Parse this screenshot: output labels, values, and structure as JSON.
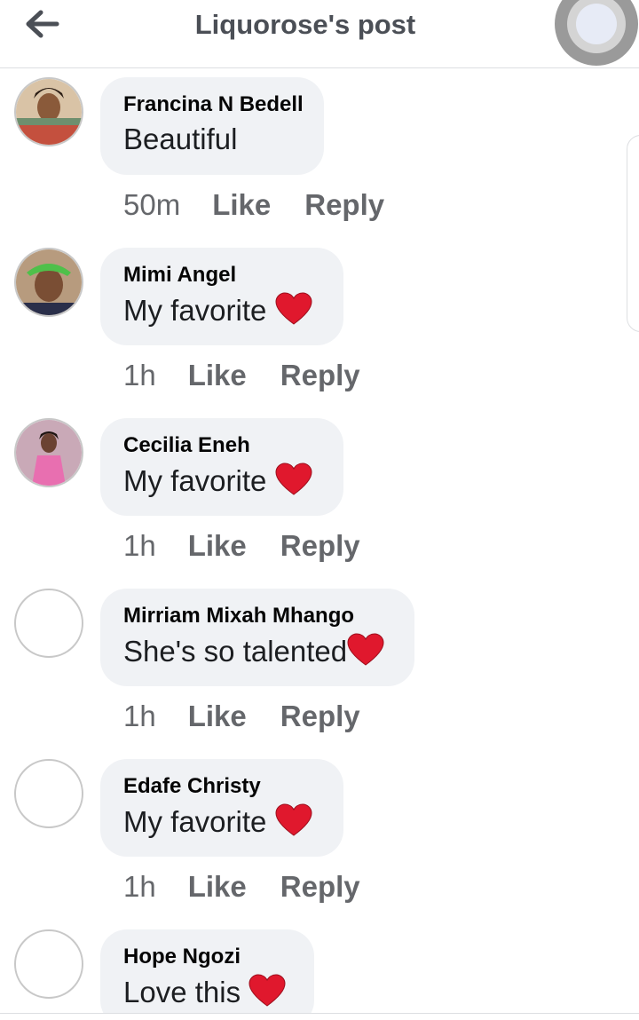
{
  "header": {
    "title": "Liquorose's post",
    "back_icon": "arrow-left-icon"
  },
  "colors": {
    "bubble_bg": "#f0f2f5",
    "meta_text": "#65676b",
    "heart": "#e0182d"
  },
  "comments": [
    {
      "name": "Francina N Bedell",
      "text": "Beautiful",
      "heart": false,
      "time": "50m",
      "like": "Like",
      "reply": "Reply",
      "avatar": "photo"
    },
    {
      "name": "Mimi Angel",
      "text": "My favorite",
      "heart": true,
      "time": "1h",
      "like": "Like",
      "reply": "Reply",
      "avatar": "photo"
    },
    {
      "name": "Cecilia Eneh",
      "text": "My favorite",
      "heart": true,
      "time": "1h",
      "like": "Like",
      "reply": "Reply",
      "avatar": "photo"
    },
    {
      "name": "Mirriam Mixah Mhango",
      "text": "She's so talented",
      "heart": true,
      "time": "1h",
      "like": "Like",
      "reply": "Reply",
      "avatar": "blank"
    },
    {
      "name": "Edafe Christy",
      "text": "My favorite",
      "heart": true,
      "time": "1h",
      "like": "Like",
      "reply": "Reply",
      "avatar": "blank"
    },
    {
      "name": "Hope Ngozi",
      "text": "Love this",
      "heart": true,
      "time": "",
      "like": "",
      "reply": "",
      "avatar": "blank"
    }
  ]
}
